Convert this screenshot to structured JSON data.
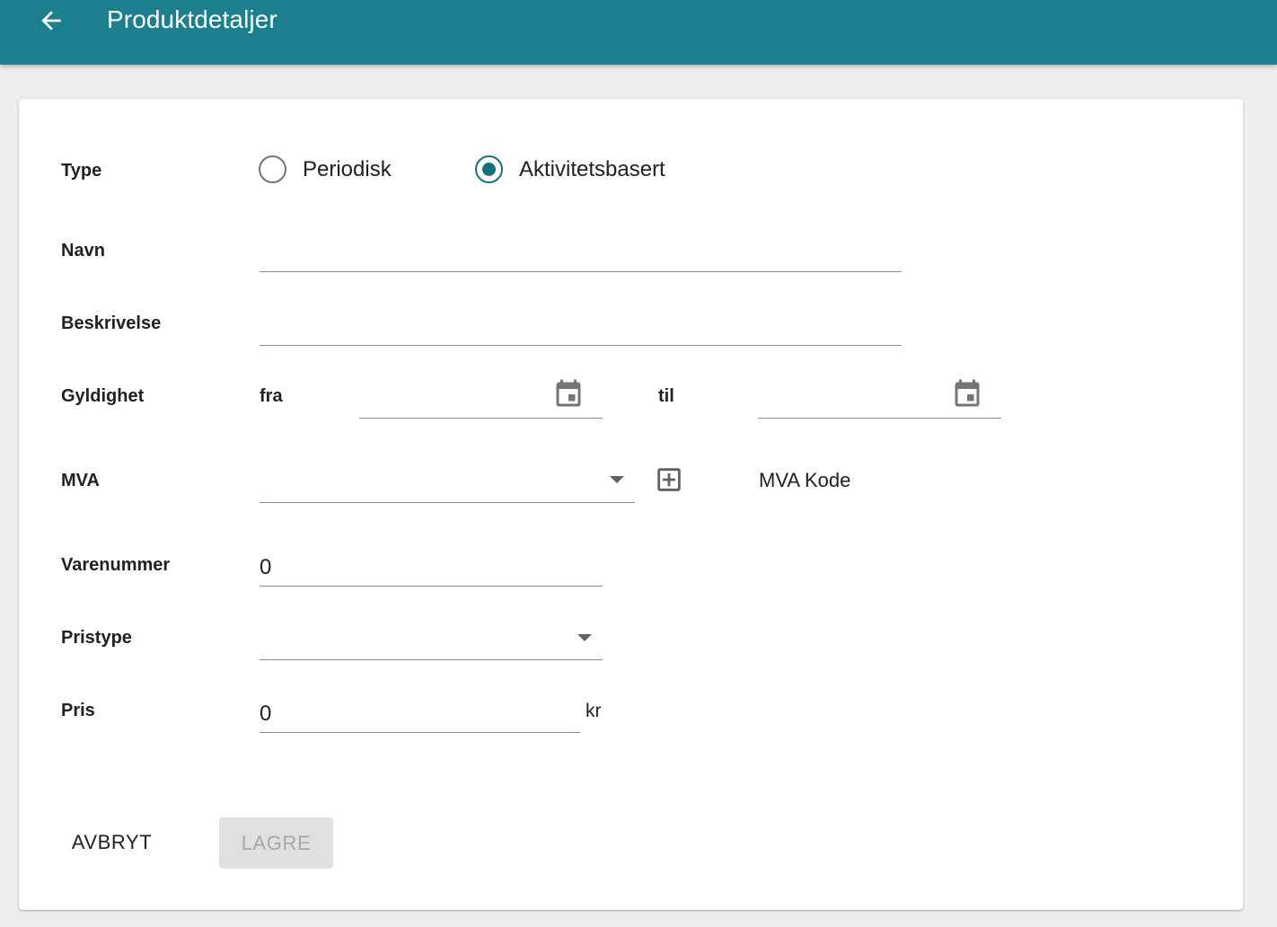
{
  "header": {
    "title": "Produktdetaljer",
    "background_color": "#1b7f8e"
  },
  "form": {
    "type": {
      "label": "Type",
      "options": [
        {
          "label": "Periodisk",
          "selected": false
        },
        {
          "label": "Aktivitetsbasert",
          "selected": true
        }
      ]
    },
    "name": {
      "label": "Navn",
      "value": ""
    },
    "description": {
      "label": "Beskrivelse",
      "value": ""
    },
    "validity": {
      "label": "Gyldighet",
      "from_label": "fra",
      "from_value": "",
      "to_label": "til",
      "to_value": ""
    },
    "vat": {
      "label": "MVA",
      "selected": "",
      "code_label": "MVA Kode"
    },
    "item_number": {
      "label": "Varenummer",
      "value": "0"
    },
    "price_type": {
      "label": "Pristype",
      "selected": ""
    },
    "price": {
      "label": "Pris",
      "value": "0",
      "unit": "kr"
    }
  },
  "actions": {
    "cancel_label": "AVBRYT",
    "save_label": "LAGRE",
    "save_enabled": false
  },
  "colors": {
    "accent": "#17707d",
    "card": "#ffffff",
    "page_background": "#eeeeee"
  },
  "icons": {
    "back": "arrow-left-icon",
    "date": "calendar-icon",
    "dropdown": "caret-down-icon",
    "add": "plus-box-icon"
  }
}
